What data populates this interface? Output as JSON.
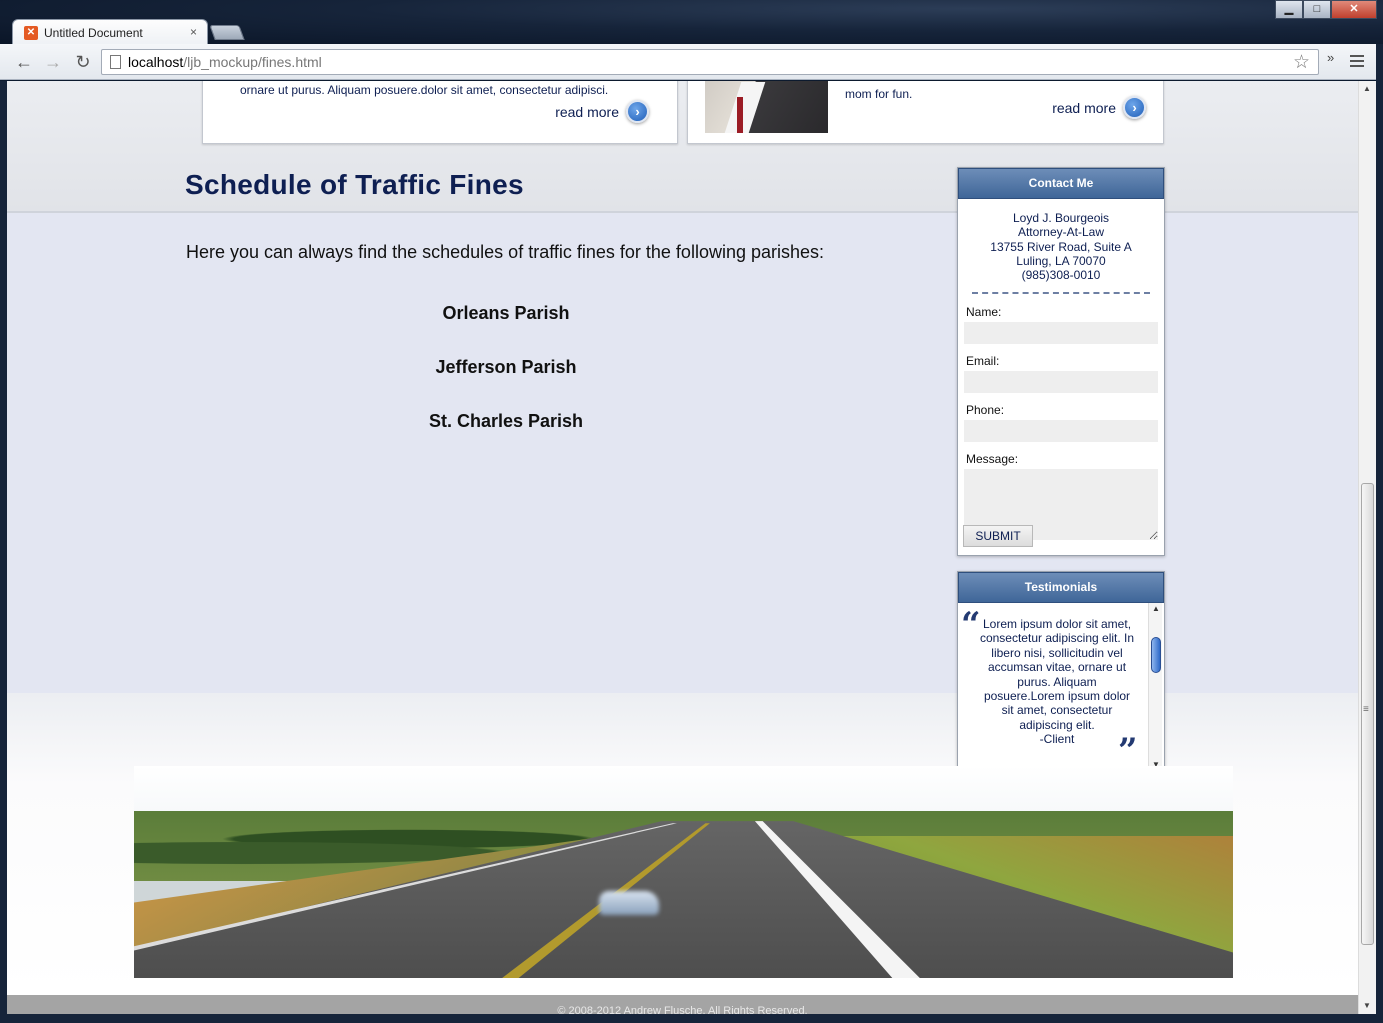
{
  "browser": {
    "tab_title": "Untitled Document",
    "tab_close": "×",
    "url_host": "localhost",
    "url_path": "/ljb_mockup/fines.html",
    "extensions_glyph": "»",
    "window_buttons": {
      "minimize": "▁",
      "maximize": "□",
      "close": "✕"
    }
  },
  "teasers": [
    {
      "text": "ornare ut purus. Aliquam posuere.dolor sit amet, consectetur adipisci.",
      "read_more": "read more"
    },
    {
      "text": "mom for fun.",
      "read_more": "read more"
    }
  ],
  "main": {
    "title": "Schedule of Traffic Fines",
    "intro": "Here you can always find the schedules of traffic fines for the following parishes:",
    "parishes": [
      "Orleans Parish",
      "Jefferson Parish",
      "St. Charles Parish"
    ]
  },
  "contact": {
    "heading": "Contact Me",
    "name": "Loyd J. Bourgeois",
    "role": "Attorney-At-Law",
    "address1": "13755 River Road, Suite A",
    "address2": "Luling, LA 70070",
    "phone": "(985)308-0010",
    "labels": {
      "name": "Name:",
      "email": "Email:",
      "phone": "Phone:",
      "message": "Message:"
    },
    "values": {
      "name": "",
      "email": "",
      "phone": "",
      "message": ""
    },
    "submit": "SUBMIT"
  },
  "testimonials": {
    "heading": "Testimonials",
    "text": "Lorem ipsum dolor sit amet, consectetur adipiscing elit. In libero nisi, sollicitudin vel accumsan vitae, ornare ut purus. Aliquam posuere.Lorem ipsum dolor sit amet, consectetur adipiscing elit.",
    "author": "-Client",
    "quote_open": "“",
    "quote_close": "”"
  },
  "footer": {
    "copyright": "© 2008-2012 Andrew Flusche. All Rights Reserved."
  },
  "colors": {
    "navy": "#0e1f52",
    "widget_header": "#3f6698",
    "main_band": "#e3e6f2"
  }
}
